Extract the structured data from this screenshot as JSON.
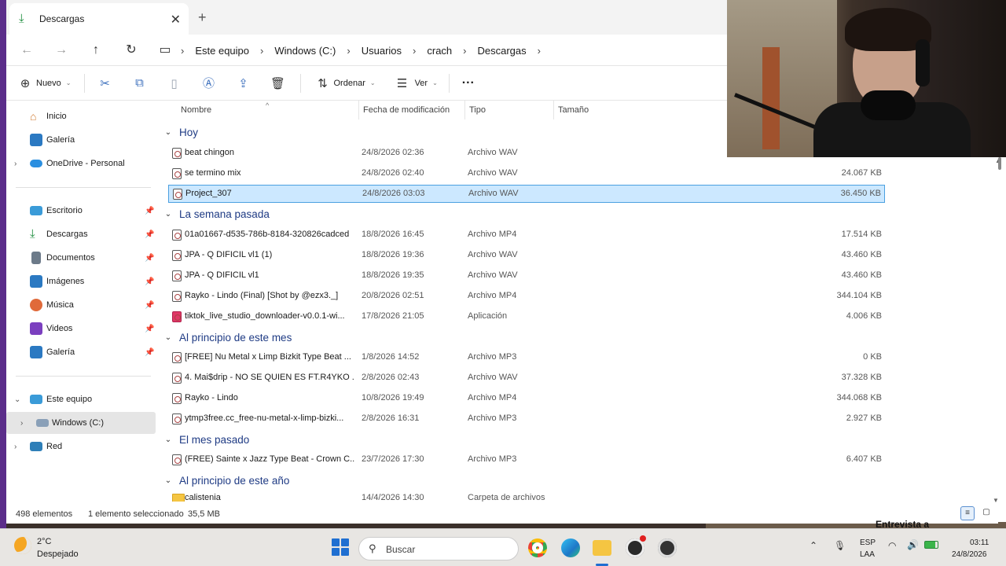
{
  "window": {
    "tab_title": "Descargas",
    "tab_close": "✕",
    "new_tab": "+"
  },
  "nav": {
    "back": "←",
    "forward": "→",
    "up": "↑",
    "refresh": "↻",
    "pc_icon": "▭"
  },
  "breadcrumb": [
    "Este equipo",
    "Windows (C:)",
    "Usuarios",
    "crach",
    "Descargas"
  ],
  "toolbar": {
    "new_label": "Nuevo",
    "sort_label": "Ordenar",
    "view_label": "Ver",
    "more_label": "···"
  },
  "sidebar": {
    "home": "Inicio",
    "gallery": "Galería",
    "onedrive": "OneDrive - Personal",
    "desktop": "Escritorio",
    "downloads": "Descargas",
    "documents": "Documentos",
    "images": "Imágenes",
    "music": "Música",
    "videos": "Videos",
    "gallery2": "Galería",
    "this_pc": "Este equipo",
    "windows_c": "Windows (C:)",
    "network": "Red"
  },
  "columns": {
    "name": "Nombre",
    "date": "Fecha de modificación",
    "type": "Tipo",
    "size": "Tamaño"
  },
  "groups": {
    "today": "Hoy",
    "last_week": "La semana pasada",
    "early_month": "Al principio de este mes",
    "last_month": "El mes pasado",
    "early_year": "Al principio de este año"
  },
  "files": [
    {
      "name": "beat chingon",
      "date": "24/8/2026 02:36",
      "type": "Archivo WAV",
      "size": ""
    },
    {
      "name": "se termino mix",
      "date": "24/8/2026 02:40",
      "type": "Archivo WAV",
      "size": "24.067 KB"
    },
    {
      "name": "Project_307",
      "date": "24/8/2026 03:03",
      "type": "Archivo WAV",
      "size": "36.450 KB"
    },
    {
      "name": "01a01667-d535-786b-8184-320826cadced",
      "date": "18/8/2026 16:45",
      "type": "Archivo MP4",
      "size": "17.514 KB"
    },
    {
      "name": "JPA - Q DIFICIL vl1 (1)",
      "date": "18/8/2026 19:36",
      "type": "Archivo WAV",
      "size": "43.460 KB"
    },
    {
      "name": "JPA - Q DIFICIL vl1",
      "date": "18/8/2026 19:35",
      "type": "Archivo WAV",
      "size": "43.460 KB"
    },
    {
      "name": "Rayko - Lindo (Final) [Shot by @ezx3._]",
      "date": "20/8/2026 02:51",
      "type": "Archivo MP4",
      "size": "344.104 KB"
    },
    {
      "name": "tiktok_live_studio_downloader-v0.0.1-wi...",
      "date": "17/8/2026 21:05",
      "type": "Aplicación",
      "size": "4.006 KB"
    },
    {
      "name": "[FREE] Nu Metal x Limp Bizkit Type Beat ...",
      "date": "1/8/2026 14:52",
      "type": "Archivo MP3",
      "size": "0 KB"
    },
    {
      "name": "4. Mai$drip - NO SE QUIEN ES FT.R4YKO ...",
      "date": "2/8/2026 02:43",
      "type": "Archivo WAV",
      "size": "37.328 KB"
    },
    {
      "name": "Rayko - Lindo",
      "date": "10/8/2026 19:49",
      "type": "Archivo MP4",
      "size": "344.068 KB"
    },
    {
      "name": "ytmp3free.cc_free-nu-metal-x-limp-bizki...",
      "date": "2/8/2026 16:31",
      "type": "Archivo MP3",
      "size": "2.927 KB"
    },
    {
      "name": "(FREE) Sainte x Jazz Type Beat - Crown  C...",
      "date": "23/7/2026 17:30",
      "type": "Archivo MP3",
      "size": "6.407 KB"
    },
    {
      "name": "calistenia",
      "date": "14/4/2026 14:30",
      "type": "Carpeta de archivos",
      "size": ""
    }
  ],
  "status": {
    "count": "498 elementos",
    "selected": "1 elemento seleccionado",
    "size": "35,5 MB"
  },
  "news_snippet": "Entrevista a",
  "taskbar": {
    "temp": "2°C",
    "weather": "Despejado",
    "search_placeholder": "Buscar",
    "lang1": "ESP",
    "lang2": "LAA",
    "time": "03:11",
    "date": "24/8/2026"
  },
  "colors": {
    "accent": "#1f6fd1",
    "selection_bg": "#cce8ff",
    "group_text": "#1f3b84"
  }
}
